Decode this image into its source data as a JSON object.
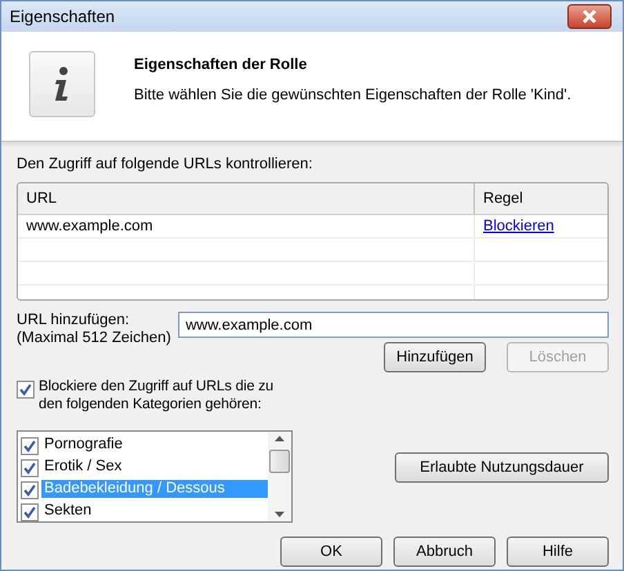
{
  "window": {
    "title": "Eigenschaften"
  },
  "header": {
    "title": "Eigenschaften der Rolle",
    "text": "Bitte wählen Sie die gewünschten Eigenschaften der Rolle 'Kind'."
  },
  "url_section": {
    "label": "Den Zugriff auf folgende URLs kontrollieren:"
  },
  "table": {
    "columns": [
      "URL",
      "Regel"
    ],
    "rows": [
      {
        "url": "www.example.com",
        "rule": "Blockieren"
      }
    ]
  },
  "add_url": {
    "label": "URL hinzufügen:",
    "hint": "(Maximal 512 Zeichen)",
    "value": "www.example.com"
  },
  "buttons_url": [
    {
      "label": "Hinzufügen",
      "disabled": false
    },
    {
      "label": "Löschen",
      "disabled": true
    }
  ],
  "block_categories": {
    "label": "Blockiere den Zugriff auf URLs die zu den folgenden Kategorien gehören:",
    "checked": true
  },
  "categories": [
    {
      "label": "Pornografie",
      "checked": true,
      "selected": false
    },
    {
      "label": "Erotik / Sex",
      "checked": true,
      "selected": false
    },
    {
      "label": "Badebekleidung / Dessous",
      "checked": true,
      "selected": true
    },
    {
      "label": "Sekten",
      "checked": true,
      "selected": false
    }
  ],
  "usage_button": "Erlaubte Nutzungsdauer",
  "buttons": [
    "OK",
    "Abbruch",
    "Hilfe"
  ]
}
